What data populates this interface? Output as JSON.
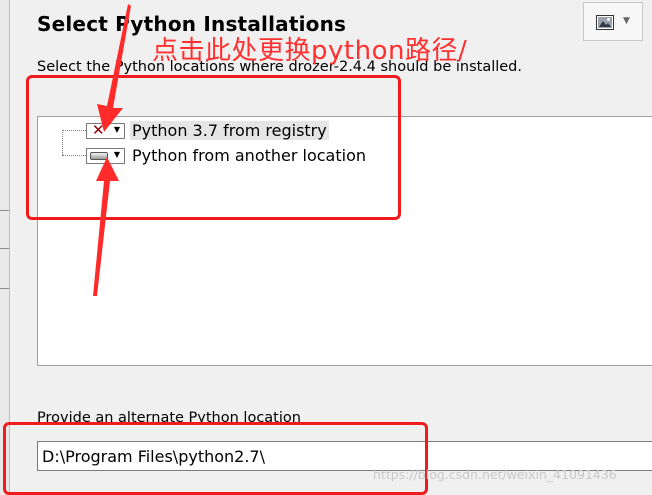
{
  "header": {
    "title": "Select Python Installations",
    "subtitle": "Select the Python locations where drozer-2.4.4 should be installed."
  },
  "toolbar": {
    "image_button_icon": "image-icon",
    "dropdown_icon": "chevron-down-icon"
  },
  "tree": {
    "items": [
      {
        "label": "Python 3.7 from registry",
        "state_icon": "x-icon",
        "selected": true
      },
      {
        "label": "Python from another location",
        "state_icon": "drive-icon",
        "selected": false
      }
    ]
  },
  "alternate": {
    "label": "Provide an alternate Python location",
    "value": "D:\\Program Files\\python2.7\\"
  },
  "annotation": {
    "text": "点击此处更换python路径/",
    "color": "#ff3030"
  },
  "watermark": "https://blog.csdn.net/weixin_41091436",
  "colors": {
    "annotation_red": "#ee1c1c",
    "background": "#f0f0f0"
  }
}
